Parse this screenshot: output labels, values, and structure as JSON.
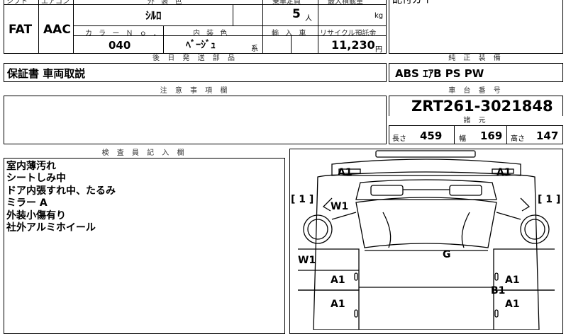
{
  "top": {
    "headers": {
      "shift": "シフト",
      "aircon": "エアコン",
      "exterior_color": "外 装 色",
      "capacity": "乗車定員",
      "max_load": "最大積載量",
      "color_no": "カ ラ ー Ｎ ｏ ．",
      "interior_color": "内 装 色",
      "import": "輸 入 車",
      "recycle": "リサイクル預託金"
    },
    "shift_value": "FAT",
    "aircon_value": "AAC",
    "exterior_color_value": "ｼﾙﾛ",
    "capacity_value": "5",
    "capacity_unit": "人",
    "max_load_unit": "kg",
    "color_no_value": "040",
    "interior_color_value": "ﾍﾞｰｼﾞｭ",
    "interior_color_suffix": "系",
    "recycle_value": "11,230",
    "recycle_unit": "円",
    "right_top_text": "配付ガイ"
  },
  "later_parts": {
    "header": "後 日 発 送 部 品",
    "value": "保証書 車両取説"
  },
  "genuine_equipment": {
    "header": "純 正 装 備",
    "value": "ABS ｴｱB PS PW"
  },
  "notes": {
    "header": "注 意 事 項 欄",
    "value": ""
  },
  "chassis": {
    "header": "車 台 番 号",
    "value": "ZRT261-3021848"
  },
  "specs": {
    "header": "諸 元",
    "length_label": "長さ",
    "length": "459",
    "width_label": "幅",
    "width": "169",
    "height_label": "高さ",
    "height": "147"
  },
  "inspector": {
    "header": "検 査 員 記 入 欄",
    "lines": [
      "室内薄汚れ",
      "シートしみ中",
      "ドア内張すれ中、たるみ",
      "ミラー A",
      "外装小傷有り",
      "社外アルミホイール"
    ]
  },
  "diagram_marks": {
    "a1_front_left": "A1",
    "a1_front_right": "A1",
    "w1_hood": "W1",
    "w1_side": "W1",
    "g_roof": "G",
    "a1_mid_left": "A1",
    "a1_mid_right": "A1",
    "b1_mid_right": "B1",
    "a1_low_left": "A1",
    "a1_low_right": "A1",
    "bracket_left": "[ 1 ]",
    "bracket_right": "[ 1 ]"
  }
}
